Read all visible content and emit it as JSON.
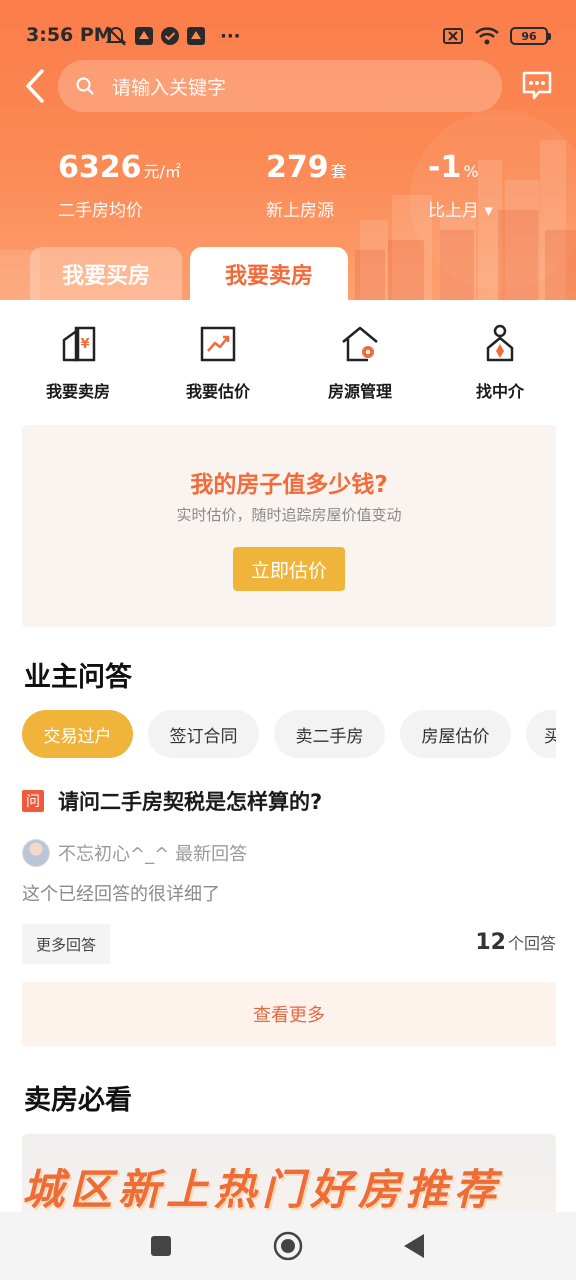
{
  "status_bar": {
    "time": "3:56 PM",
    "more": "···",
    "battery": "96"
  },
  "search": {
    "placeholder": "请输入关键字"
  },
  "stats": [
    {
      "value": "6326",
      "unit": "元/㎡",
      "label": "二手房均价"
    },
    {
      "value": "279",
      "unit": "套",
      "label": "新上房源"
    },
    {
      "value": "-1",
      "unit": "%",
      "label": "比上月 ▾"
    }
  ],
  "tabs": {
    "buy": "我要买房",
    "sell": "我要卖房"
  },
  "actions": [
    {
      "label": "我要卖房",
      "icon": "sell-house-icon"
    },
    {
      "label": "我要估价",
      "icon": "valuation-chart-icon"
    },
    {
      "label": "房源管理",
      "icon": "house-settings-icon"
    },
    {
      "label": "找中介",
      "icon": "agent-icon"
    }
  ],
  "valuation": {
    "title": "我的房子值多少钱?",
    "subtitle": "实时估价，随时追踪房屋价值变动",
    "button": "立即估价"
  },
  "qa": {
    "title": "业主问答",
    "chips": [
      "交易过户",
      "签订合同",
      "卖二手房",
      "房屋估价",
      "买"
    ],
    "badge": "问",
    "question": "请问二手房契税是怎样算的?",
    "answerer": "不忘初心^_^",
    "answerer_tag": "最新回答",
    "answer": "这个已经回答的很详细了",
    "more_answers": "更多回答",
    "answer_count": "12",
    "answer_count_unit": "个回答",
    "see_more": "查看更多"
  },
  "must_read": {
    "title": "卖房必看",
    "banner": "城区新上热门好房推荐"
  },
  "colors": {
    "header": "#fb7d4a",
    "accent": "#f4693a",
    "yellow": "#f0b43a"
  }
}
